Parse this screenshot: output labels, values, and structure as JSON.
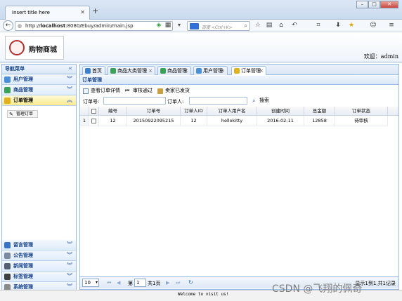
{
  "browser": {
    "tab_title": "Insert title here",
    "url_prefix": "http://",
    "url_host": "localhost",
    "url_rest": ":8080/Ebuy/admin/main.jsp",
    "search_placeholder": "百度 <Ctrl+K>"
  },
  "header": {
    "logo_text": "购物商城",
    "welcome": "欢迎：admin"
  },
  "sidebar": {
    "title": "导航菜单",
    "top_items": [
      {
        "label": "用户管理",
        "color": "#4a90d9"
      },
      {
        "label": "商品管理",
        "color": "#3aa35a"
      },
      {
        "label": "订单管理",
        "color": "#e0b020"
      }
    ],
    "sub_item": "管理订单",
    "bottom_items": [
      {
        "label": "留言管理",
        "color": "#3a74c4"
      },
      {
        "label": "公告管理",
        "color": "#7c8aa0"
      },
      {
        "label": "新闻管理",
        "color": "#556070"
      },
      {
        "label": "标签管理",
        "color": "#404040"
      },
      {
        "label": "系统管理",
        "color": "#8a8a8a"
      }
    ]
  },
  "tabs": [
    {
      "label": "首页",
      "closable": false,
      "color": "#3a7fd0"
    },
    {
      "label": "商品大类管理",
      "closable": true,
      "color": "#3aa35a"
    },
    {
      "label": "商品管理",
      "closable": true,
      "color": "#3aa35a"
    },
    {
      "label": "用户管理",
      "closable": true,
      "color": "#4a90d9"
    },
    {
      "label": "订单管理",
      "closable": true,
      "color": "#e0b020"
    }
  ],
  "panel": {
    "title": "订单管理",
    "actions": [
      "查看订单详情",
      "审核通过",
      "卖家已发货"
    ],
    "filter_order_label": "订单号:",
    "filter_user_label": "订单人:",
    "search_button": "搜索"
  },
  "grid": {
    "columns": [
      "编号",
      "订单号",
      "订单人ID",
      "订单人用户名",
      "创建时间",
      "总金额",
      "订单状态"
    ],
    "rows": [
      {
        "index": "1",
        "cells": [
          "12",
          "20150922095215",
          "12",
          "hellokitty",
          "2016-02-11",
          "12858",
          "待审核"
        ]
      }
    ]
  },
  "pager": {
    "page_size": "10",
    "page_prefix": "第",
    "page_number": "1",
    "page_suffix": "共1页",
    "summary": "显示1到1,共1记录"
  },
  "footer": "Welcome to visit us!",
  "watermark": "CSDN @飞翔的佩奇"
}
